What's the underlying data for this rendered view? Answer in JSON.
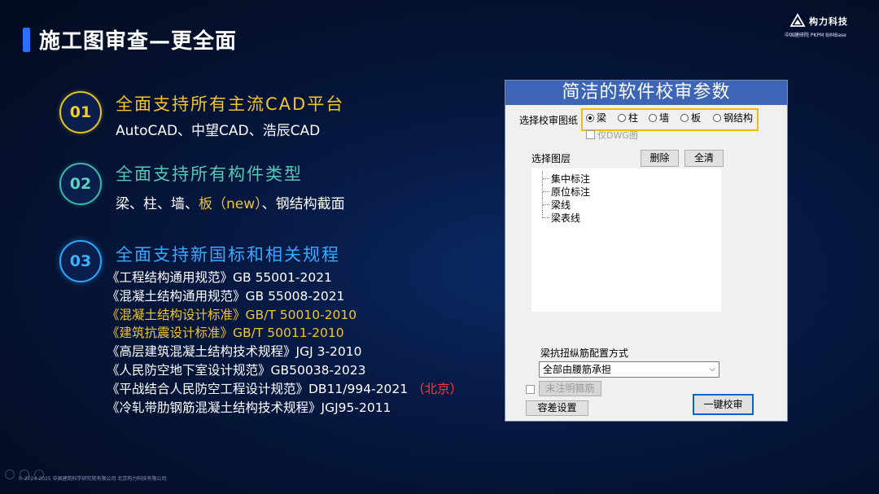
{
  "slide": {
    "title": "施工图审查—更全面",
    "logo_cn": "构力科技",
    "logo_sub": "中国建研院  PKPM BIMBase",
    "footer": "© 2024-2025 中国建筑科学研究院有限公司 北京构力科技有限公司"
  },
  "items": [
    {
      "num": "01",
      "heading": "全面支持所有主流CAD平台",
      "sub": "AutoCAD、中望CAD、浩辰CAD"
    },
    {
      "num": "02",
      "heading": "全面支持所有构件类型",
      "sub_pre": "梁、柱、墙、",
      "sub_hl": "板（new）",
      "sub_post": "、钢结构截面"
    },
    {
      "num": "03",
      "heading": "全面支持新国标和相关规程"
    }
  ],
  "specs": [
    "《工程结构通用规范》GB 55001-2021",
    "《混凝土结构通用规范》GB 55008-2021",
    "《混凝土结构设计标准》GB/T 50010-2010",
    "《建筑抗震设计标准》GB/T 50011-2010",
    "《高层建筑混凝土结构技术规程》JGJ 3-2010",
    "《人民防空地下室设计规范》GB50038-2023",
    "《平战结合人民防空工程设计规范》DB11/994-2021",
    "《冷轧带肋钢筋混凝土结构技术规程》JGJ95-2011"
  ],
  "spec_note": "（北京）",
  "dialog": {
    "title": "简洁的软件校审参数",
    "select_label": "选择校审图纸",
    "radios": [
      "梁",
      "柱",
      "墙",
      "板",
      "钢结构"
    ],
    "selected": "梁",
    "dwg_only": "仅DWG图",
    "layer_label": "选择图层",
    "delete_btn": "删除",
    "clear_btn": "全清",
    "layers": [
      "集中标注",
      "原位标注",
      "梁线",
      "梁表线"
    ],
    "torsion_label": "梁抗扭纵筋配置方式",
    "torsion_value": "全部由腰筋承担",
    "unmarked_btn": "未注明箍筋",
    "tolerance_btn": "容差设置",
    "check_btn": "一键校审"
  },
  "colors": {
    "accent_gold": "#f0c62b",
    "accent_teal": "#56c7b5",
    "accent_blue": "#36a9ff",
    "dialog_title_bg": "#3c66b5",
    "highlight_box": "#f2b817"
  }
}
